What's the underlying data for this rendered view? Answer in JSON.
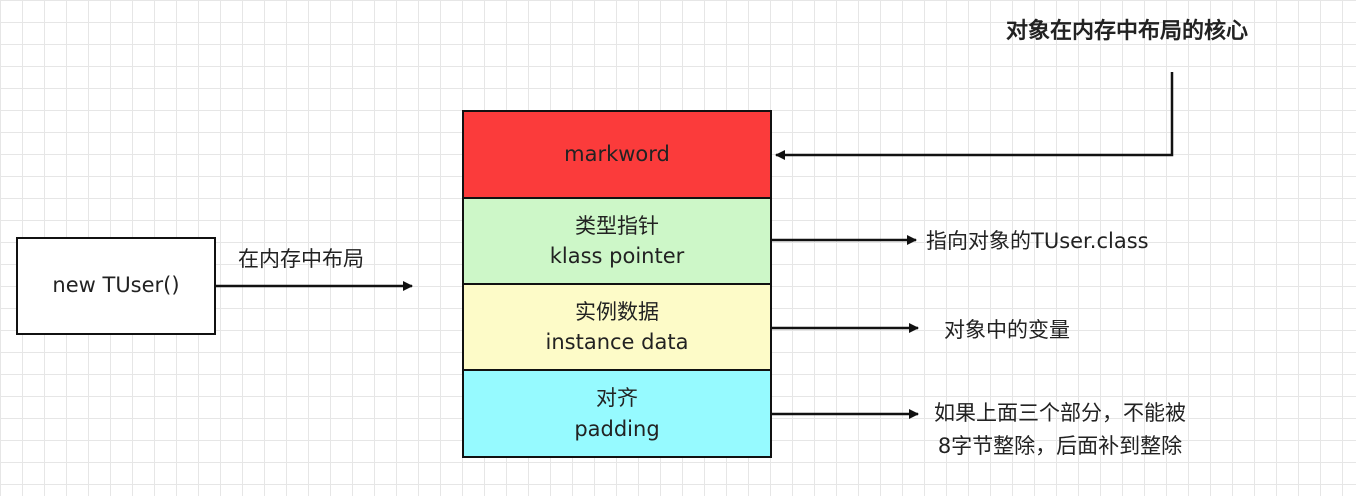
{
  "new_box": {
    "label": "new TUser()"
  },
  "alloc_label": "在内存中布局",
  "core_label": "对象在内存中布局的核心",
  "blocks": {
    "markword": {
      "line1": "markword",
      "color": "#fb3b3b"
    },
    "klass": {
      "line1": "类型指针",
      "line2": "klass pointer",
      "color": "#cdf7c8"
    },
    "instance": {
      "line1": "实例数据",
      "line2": "instance data",
      "color": "#fdfbc8"
    },
    "padding": {
      "line1": "对齐",
      "line2": "padding",
      "color": "#96faff"
    }
  },
  "notes": {
    "klass": "指向对象的TUser.class",
    "instance": "对象中的变量",
    "padding_line1": "如果上面三个部分，不能被",
    "padding_line2": "8字节整除，后面补到整除"
  }
}
